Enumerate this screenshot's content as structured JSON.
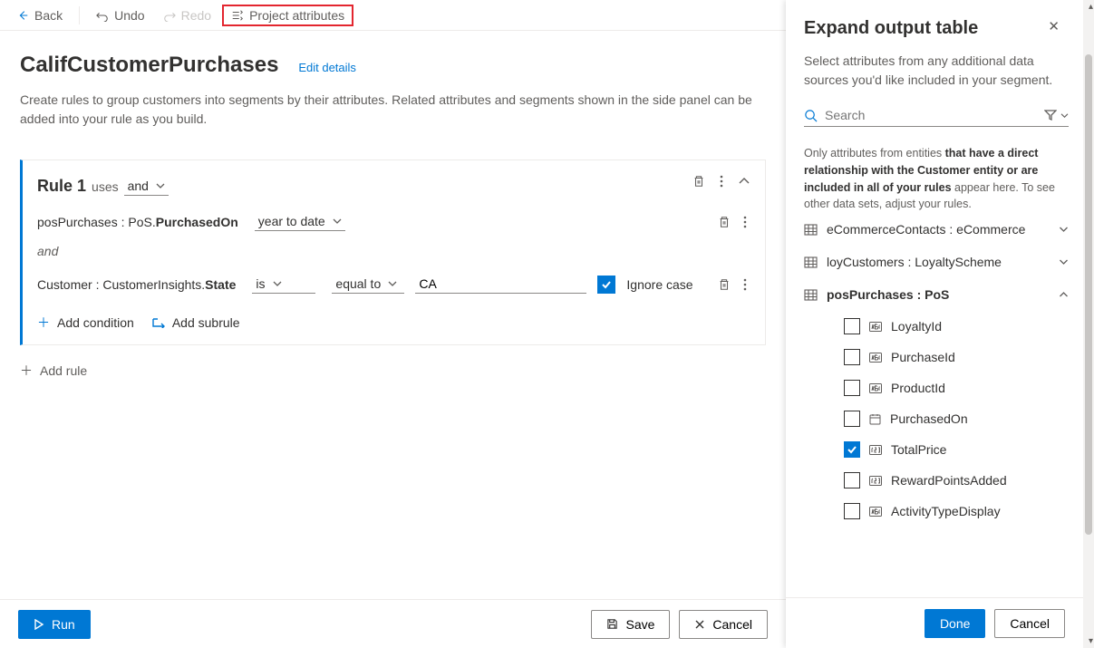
{
  "toolbar": {
    "back": "Back",
    "undo": "Undo",
    "redo": "Redo",
    "project_attributes": "Project attributes"
  },
  "page": {
    "title": "CalifCustomerPurchases",
    "edit": "Edit details",
    "description": "Create rules to group customers into segments by their attributes. Related attributes and segments shown in the side panel can be added into your rule as you build."
  },
  "rule": {
    "name": "Rule 1",
    "uses": "uses",
    "logic": "and",
    "cond1_attr": "posPurchases : PoS.",
    "cond1_field": "PurchasedOn",
    "cond1_op": "year to date",
    "and": "and",
    "cond2_attr": "Customer : CustomerInsights.",
    "cond2_field": "State",
    "cond2_op1": "is",
    "cond2_op2": "equal to",
    "cond2_val": "CA",
    "ignore": "Ignore case",
    "add_condition": "Add condition",
    "add_subrule": "Add subrule"
  },
  "add_rule": "Add rule",
  "footer": {
    "run": "Run",
    "save": "Save",
    "cancel": "Cancel"
  },
  "panel": {
    "title": "Expand output table",
    "desc": "Select attributes from any additional data sources you'd like included in your segment.",
    "search_placeholder": "Search",
    "hint_prefix": "Only attributes from entities ",
    "hint_bold1": "that have a direct relationship with the Customer entity or are included in all of your rules",
    "hint_suffix": " appear here. To see other data sets, adjust your rules.",
    "entities": [
      {
        "label": "eCommerceContacts : eCommerce",
        "expanded": false
      },
      {
        "label": "loyCustomers : LoyaltyScheme",
        "expanded": false
      },
      {
        "label": "posPurchases : PoS",
        "expanded": true
      }
    ],
    "attrs": [
      {
        "label": "LoyaltyId",
        "checked": false,
        "type": "abc"
      },
      {
        "label": "PurchaseId",
        "checked": false,
        "type": "abc"
      },
      {
        "label": "ProductId",
        "checked": false,
        "type": "abc"
      },
      {
        "label": "PurchasedOn",
        "checked": false,
        "type": "date"
      },
      {
        "label": "TotalPrice",
        "checked": true,
        "type": "num"
      },
      {
        "label": "RewardPointsAdded",
        "checked": false,
        "type": "num"
      },
      {
        "label": "ActivityTypeDisplay",
        "checked": false,
        "type": "abc"
      }
    ],
    "done": "Done",
    "cancel": "Cancel"
  }
}
